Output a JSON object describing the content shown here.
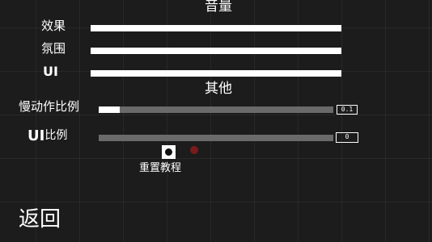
{
  "volume": {
    "title": "音量",
    "items": [
      {
        "label": "效果",
        "value": 1.0
      },
      {
        "label": "氛围",
        "value": 1.0
      },
      {
        "label": "UI",
        "value": 1.0
      }
    ]
  },
  "other": {
    "title": "其他",
    "slow_motion": {
      "label": "慢动作比例",
      "value": "0.1",
      "fill": 0.09
    },
    "ui_scale": {
      "label_prefix": "UI",
      "label_suffix": "比例",
      "value": "0",
      "fill": 0.0
    },
    "reset_tutorial": {
      "label": "重置教程"
    }
  },
  "back_label": "返回",
  "colors": {
    "accent_dot": "#8b1a1a",
    "track": "#6a6a6a"
  }
}
